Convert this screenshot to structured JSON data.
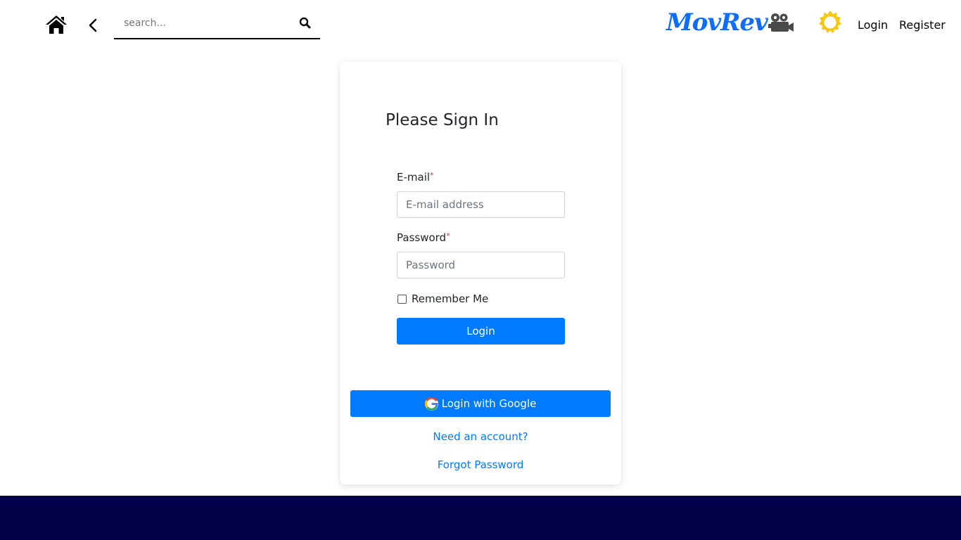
{
  "header": {
    "search_placeholder": "search...",
    "brand": "MovRev",
    "login_label": "Login",
    "register_label": "Register",
    "icons": {
      "home": "home-icon",
      "back": "chevron-left-icon",
      "search": "search-icon",
      "camera": "video-camera-icon",
      "theme": "sun-icon"
    }
  },
  "login_card": {
    "title": "Please Sign In",
    "email": {
      "label": "E-mail",
      "required_mark": "*",
      "placeholder": "E-mail address",
      "value": ""
    },
    "password": {
      "label": "Password",
      "required_mark": "*",
      "placeholder": "Password",
      "value": ""
    },
    "remember_me": {
      "label": "Remember Me",
      "checked": false
    },
    "login_button": "Login",
    "google_button": "Login with Google",
    "register_link": "Need an account?",
    "forgot_link": "Forgot Password"
  },
  "colors": {
    "brand": "#0d6efd",
    "primary": "#007bff",
    "sun": "#f6c90e",
    "footer": "#020048",
    "required": "#dc3545"
  }
}
